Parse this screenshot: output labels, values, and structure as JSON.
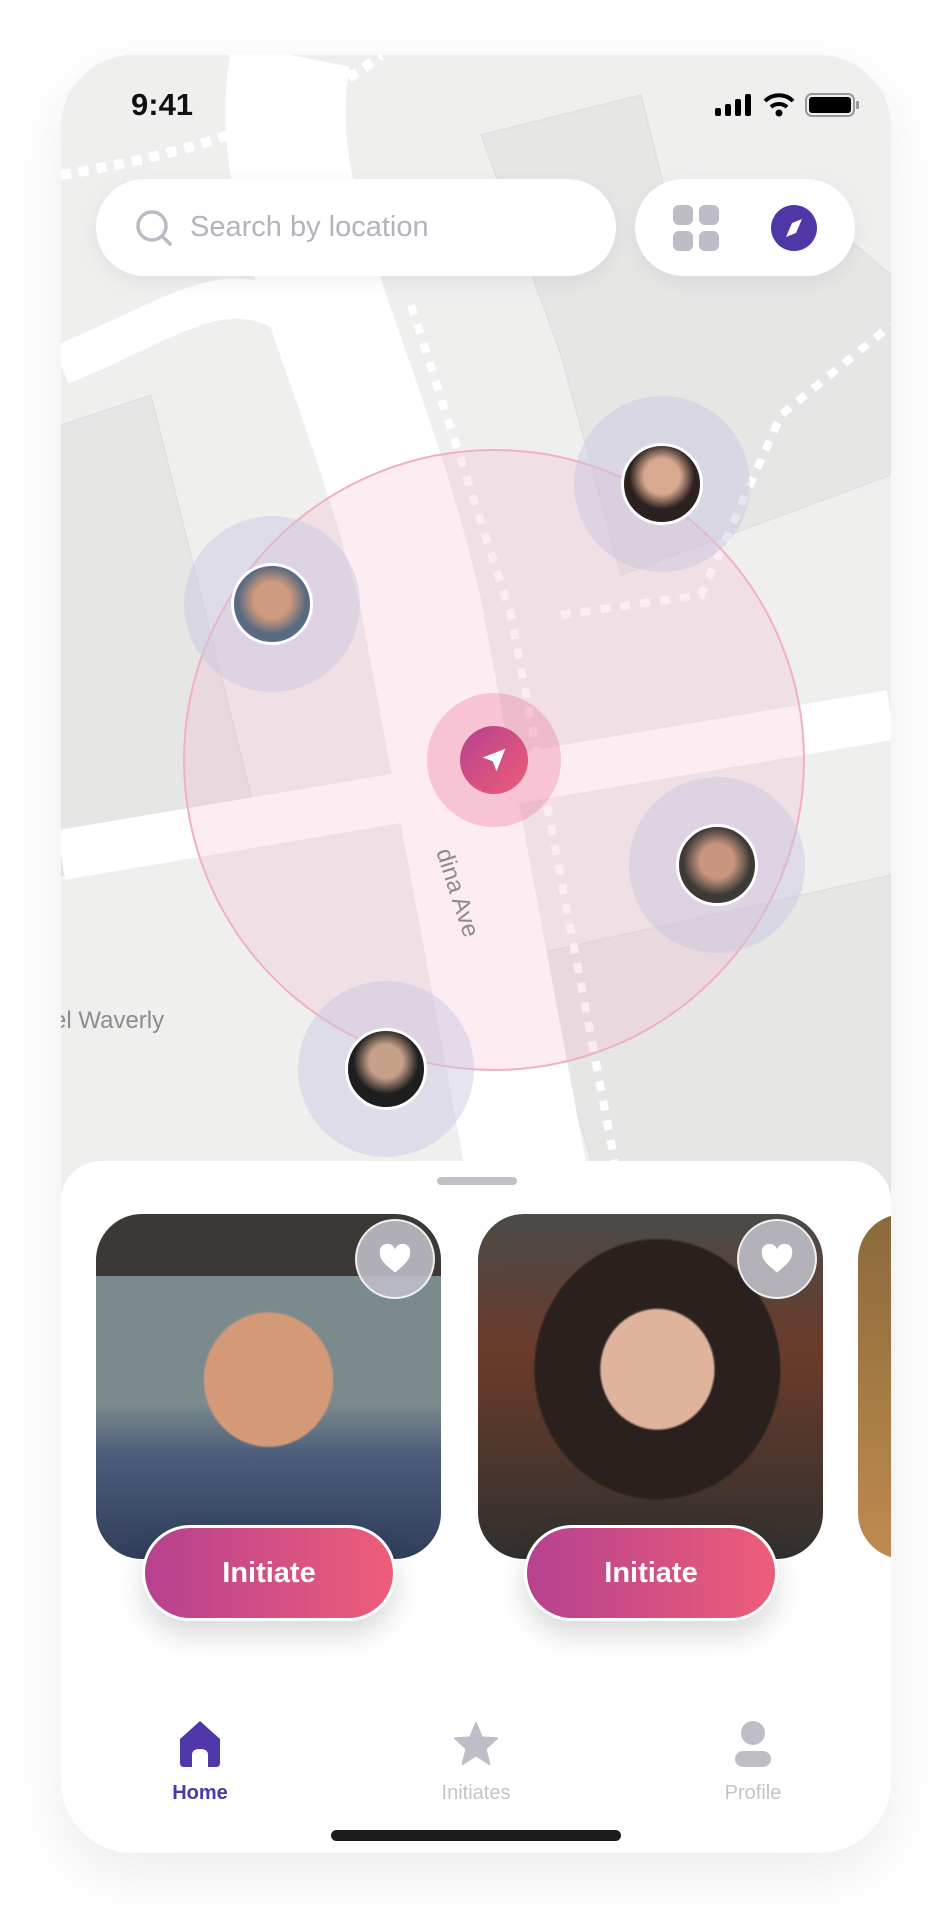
{
  "status_bar": {
    "time": "9:41"
  },
  "search": {
    "placeholder": "Search by location",
    "icon": "search-icon"
  },
  "map_controls": {
    "grid_icon": "grid-icon",
    "compass_icon": "compass-icon"
  },
  "map": {
    "street_labels": [
      "dina Ave",
      "el Waverly"
    ],
    "radius_color": "#f3b6c8",
    "current_location_icon": "navigation-arrow-icon"
  },
  "nearby_users": [
    {
      "name": "man-smiling"
    },
    {
      "name": "woman-dark-hair"
    },
    {
      "name": "young-man"
    },
    {
      "name": "man-dark-shirt"
    }
  ],
  "cards": [
    {
      "action": "Initiate",
      "favorite_icon": "heart-icon"
    },
    {
      "action": "Initiate",
      "favorite_icon": "heart-icon"
    }
  ],
  "tabs": [
    {
      "label": "Home",
      "icon": "home-icon",
      "active": true
    },
    {
      "label": "Initiates",
      "icon": "star-icon",
      "active": false
    },
    {
      "label": "Profile",
      "icon": "user-icon",
      "active": false
    }
  ],
  "colors": {
    "accent": "#4f37a8",
    "gradient_start": "#b6418f",
    "gradient_end": "#ee5d78",
    "inactive": "#bfbec8"
  }
}
